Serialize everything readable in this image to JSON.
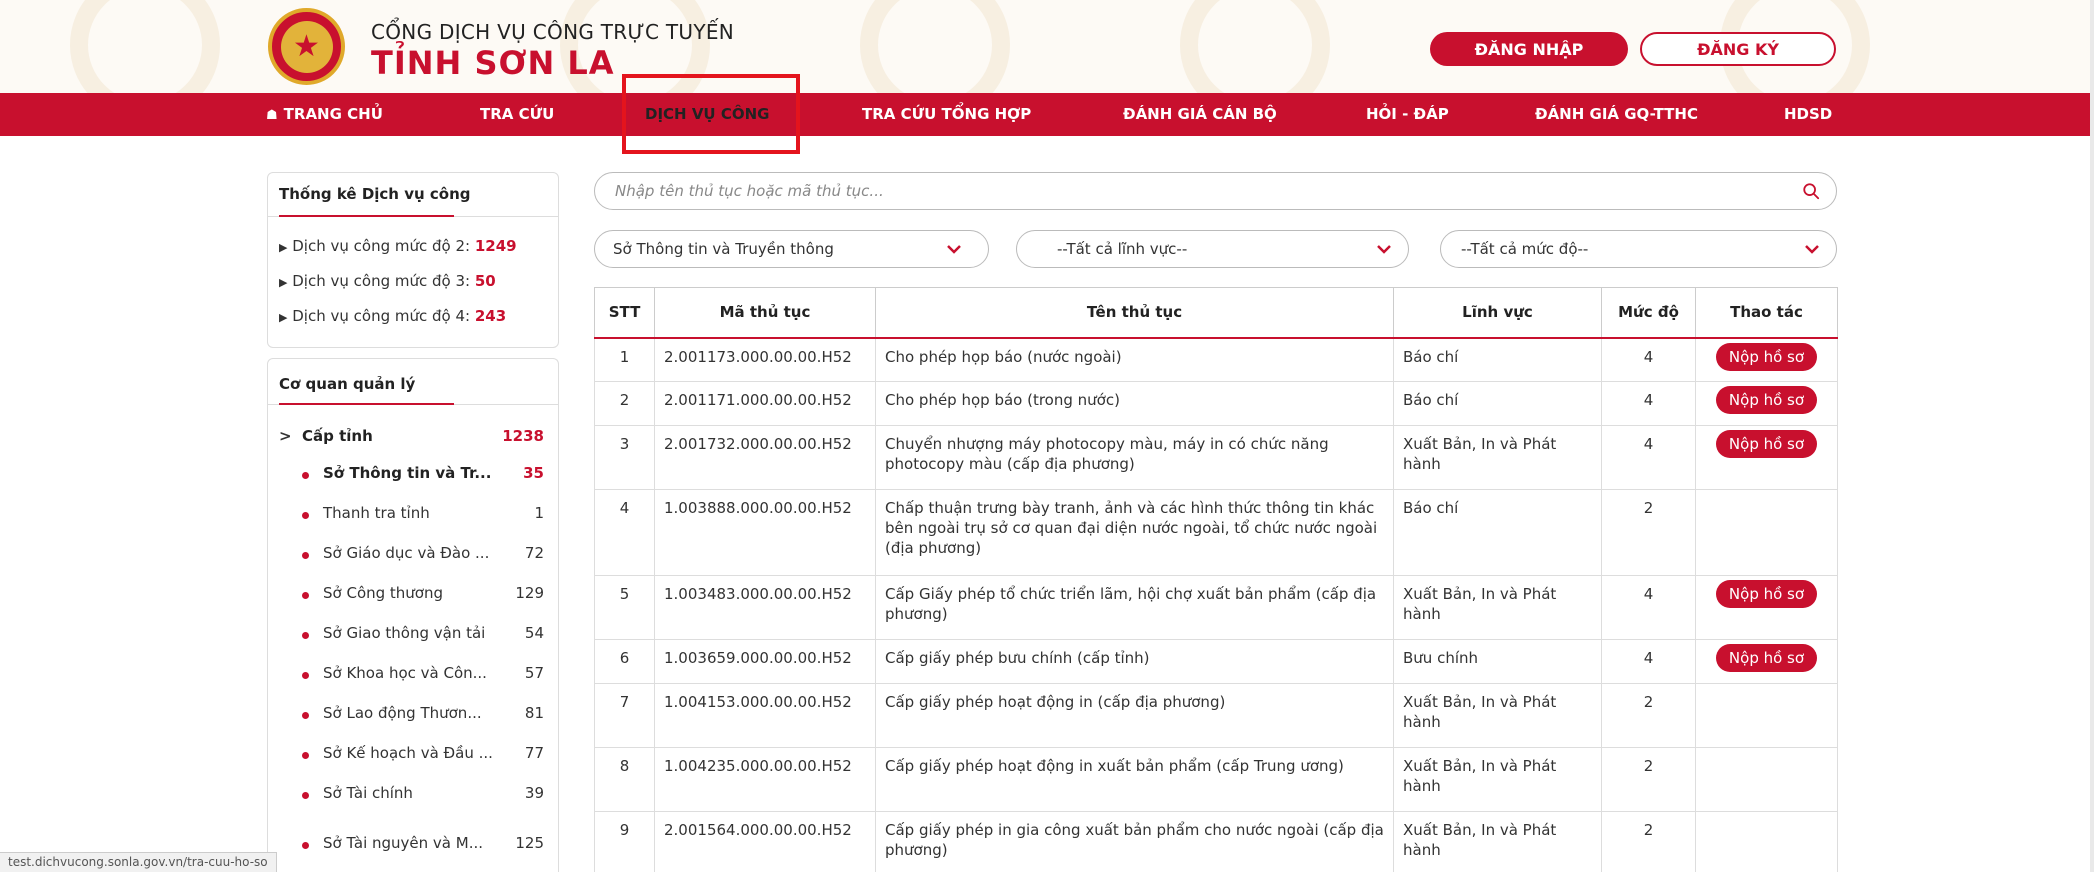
{
  "header": {
    "site_name_top": "CỔNG DỊCH VỤ CÔNG TRỰC TUYẾN",
    "site_name_bottom": "TỈNH SƠN LA",
    "login_label": "ĐĂNG NHẬP",
    "register_label": "ĐĂNG KÝ"
  },
  "nav": {
    "home": "TRANG CHỦ",
    "lookup": "TRA CỨU",
    "public_service": "DỊCH VỤ CÔNG",
    "summary_lookup": "TRA CỨU TỔNG HỢP",
    "staff_review": "ĐÁNH GIÁ CÁN BỘ",
    "qa": "HỎI - ĐÁP",
    "procedure_review": "ĐÁNH GIÁ GQ-TTHC",
    "guide": "HDSD"
  },
  "stats": {
    "title": "Thống kê Dịch vụ công",
    "items": [
      {
        "label": "Dịch vụ công mức độ 2:",
        "count": "1249"
      },
      {
        "label": "Dịch vụ công mức độ 3:",
        "count": "50"
      },
      {
        "label": "Dịch vụ công mức độ 4:",
        "count": "243"
      }
    ]
  },
  "agencies": {
    "title": "Cơ quan quản lý",
    "group_label": "Cấp tỉnh",
    "group_count": "1238",
    "items": [
      {
        "name": "Sở Thông tin và Tr...",
        "count": "35"
      },
      {
        "name": "Thanh tra tỉnh",
        "count": "1"
      },
      {
        "name": "Sở Giáo dục và Đào ...",
        "count": "72"
      },
      {
        "name": "Sở Công thương",
        "count": "129"
      },
      {
        "name": "Sở Giao thông vận tải",
        "count": "54"
      },
      {
        "name": "Sở Khoa học và Côn...",
        "count": "57"
      },
      {
        "name": "Sở Lao động Thươn...",
        "count": "81"
      },
      {
        "name": "Sở Kế hoạch và Đầu ...",
        "count": "77"
      },
      {
        "name": "Sở Tài chính",
        "count": "39"
      },
      {
        "name": "Sở Tài nguyên và M...",
        "count": "125"
      }
    ]
  },
  "search": {
    "placeholder": "Nhập tên thủ tục hoặc mã thủ tục..."
  },
  "filters": {
    "agency": "Sở Thông tin và Truyền thông",
    "field": "--Tất cả lĩnh vực--",
    "level": "--Tất cả mức độ--"
  },
  "table": {
    "headers": {
      "stt": "STT",
      "code": "Mã thủ tục",
      "name": "Tên thủ tục",
      "field": "Lĩnh vực",
      "level": "Mức độ",
      "action": "Thao tác"
    },
    "action_label": "Nộp hồ sơ",
    "rows": [
      {
        "stt": "1",
        "code": "2.001173.000.00.00.H52",
        "name": "Cho phép họp báo (nước ngoài)",
        "field": "Báo chí",
        "level": "4",
        "action": "Nộp hồ sơ"
      },
      {
        "stt": "2",
        "code": "2.001171.000.00.00.H52",
        "name": "Cho phép họp báo (trong nước)",
        "field": "Báo chí",
        "level": "4",
        "action": "Nộp hồ sơ"
      },
      {
        "stt": "3",
        "code": "2.001732.000.00.00.H52",
        "name": "Chuyển nhượng máy photocopy màu, máy in có chức năng photocopy màu (cấp địa phương)",
        "field": "Xuất Bản, In và Phát hành",
        "level": "4",
        "action": "Nộp hồ sơ"
      },
      {
        "stt": "4",
        "code": "1.003888.000.00.00.H52",
        "name": "Chấp thuận trưng bày tranh, ảnh và các hình thức thông tin khác bên ngoài trụ sở cơ quan đại diện nước ngoài, tổ chức nước ngoài (địa phương)",
        "field": "Báo chí",
        "level": "2",
        "action": ""
      },
      {
        "stt": "5",
        "code": "1.003483.000.00.00.H52",
        "name": "Cấp Giấy phép tổ chức triển lãm, hội chợ xuất bản phẩm (cấp địa phương)",
        "field": "Xuất Bản, In và Phát hành",
        "level": "4",
        "action": "Nộp hồ sơ"
      },
      {
        "stt": "6",
        "code": "1.003659.000.00.00.H52",
        "name": "Cấp giấy phép bưu chính (cấp tỉnh)",
        "field": "Bưu chính",
        "level": "4",
        "action": "Nộp hồ sơ"
      },
      {
        "stt": "7",
        "code": "1.004153.000.00.00.H52",
        "name": "Cấp giấy phép hoạt động in (cấp địa phương)",
        "field": "Xuất Bản, In và Phát hành",
        "level": "2",
        "action": ""
      },
      {
        "stt": "8",
        "code": "1.004235.000.00.00.H52",
        "name": "Cấp giấy phép hoạt động in xuất bản phẩm (cấp Trung ương)",
        "field": "Xuất Bản, In và Phát hành",
        "level": "2",
        "action": ""
      },
      {
        "stt": "9",
        "code": "2.001564.000.00.00.H52",
        "name": "Cấp giấy phép in gia công xuất bản phẩm cho nước ngoài (cấp địa phương)",
        "field": "Xuất Bản, In và Phát hành",
        "level": "2",
        "action": ""
      }
    ]
  },
  "status_bar": {
    "url": "test.dichvucong.sonla.gov.vn/tra-cuu-ho-so"
  },
  "colors": {
    "brand_red": "#c8102e",
    "gold": "#e2b33a"
  }
}
